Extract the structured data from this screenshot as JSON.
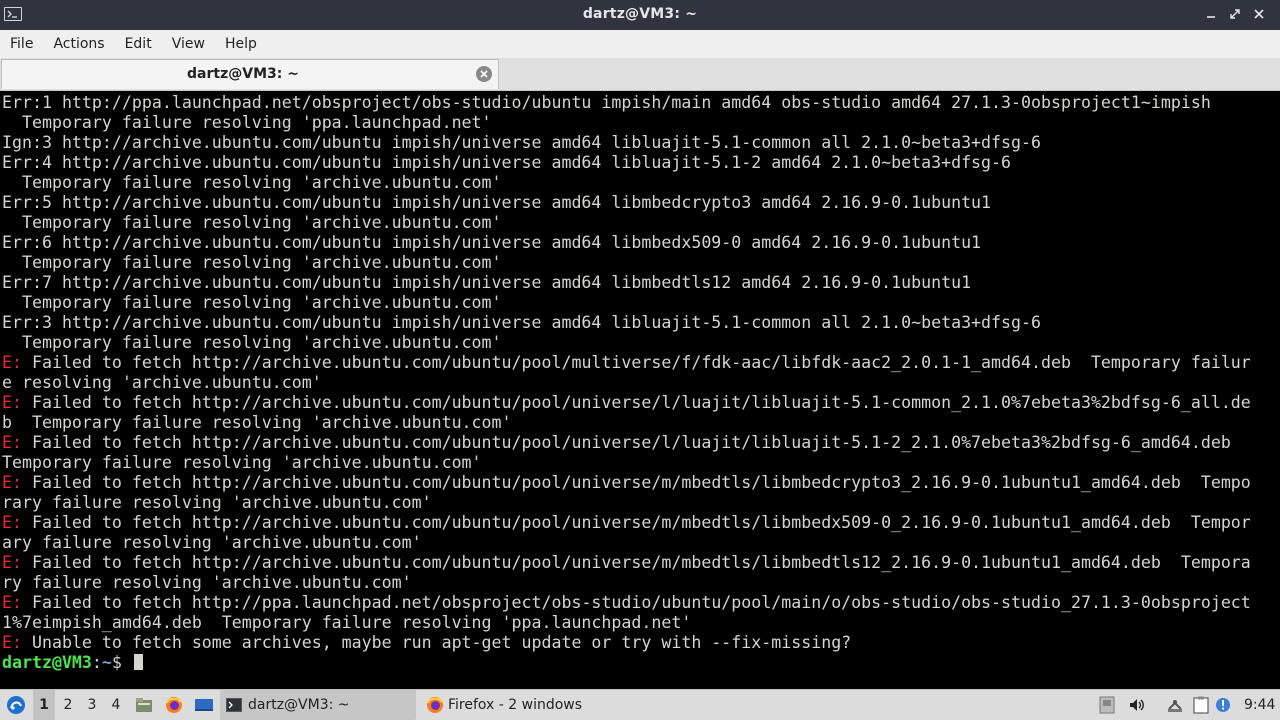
{
  "window": {
    "title": "dartz@VM3: ~"
  },
  "menubar": {
    "items": [
      "File",
      "Actions",
      "Edit",
      "View",
      "Help"
    ]
  },
  "tabs": [
    {
      "label": "dartz@VM3: ~"
    }
  ],
  "terminal": {
    "lines": [
      {
        "parts": [
          {
            "t": "Err:1 http://ppa.launchpad.net/obsproject/obs-studio/ubuntu impish/main amd64 obs-studio amd64 27.1.3-0obsproject1~impish"
          }
        ]
      },
      {
        "parts": [
          {
            "t": "  Temporary failure resolving 'ppa.launchpad.net'"
          }
        ]
      },
      {
        "parts": [
          {
            "t": "Ign:3 http://archive.ubuntu.com/ubuntu impish/universe amd64 libluajit-5.1-common all 2.1.0~beta3+dfsg-6"
          }
        ]
      },
      {
        "parts": [
          {
            "t": "Err:4 http://archive.ubuntu.com/ubuntu impish/universe amd64 libluajit-5.1-2 amd64 2.1.0~beta3+dfsg-6"
          }
        ]
      },
      {
        "parts": [
          {
            "t": "  Temporary failure resolving 'archive.ubuntu.com'"
          }
        ]
      },
      {
        "parts": [
          {
            "t": "Err:5 http://archive.ubuntu.com/ubuntu impish/universe amd64 libmbedcrypto3 amd64 2.16.9-0.1ubuntu1"
          }
        ]
      },
      {
        "parts": [
          {
            "t": "  Temporary failure resolving 'archive.ubuntu.com'"
          }
        ]
      },
      {
        "parts": [
          {
            "t": "Err:6 http://archive.ubuntu.com/ubuntu impish/universe amd64 libmbedx509-0 amd64 2.16.9-0.1ubuntu1"
          }
        ]
      },
      {
        "parts": [
          {
            "t": "  Temporary failure resolving 'archive.ubuntu.com'"
          }
        ]
      },
      {
        "parts": [
          {
            "t": "Err:7 http://archive.ubuntu.com/ubuntu impish/universe amd64 libmbedtls12 amd64 2.16.9-0.1ubuntu1"
          }
        ]
      },
      {
        "parts": [
          {
            "t": "  Temporary failure resolving 'archive.ubuntu.com'"
          }
        ]
      },
      {
        "parts": [
          {
            "t": "Err:3 http://archive.ubuntu.com/ubuntu impish/universe amd64 libluajit-5.1-common all 2.1.0~beta3+dfsg-6"
          }
        ]
      },
      {
        "parts": [
          {
            "t": "  Temporary failure resolving 'archive.ubuntu.com'"
          }
        ]
      },
      {
        "parts": [
          {
            "t": "E:",
            "c": "red"
          },
          {
            "t": " Failed to fetch http://archive.ubuntu.com/ubuntu/pool/multiverse/f/fdk-aac/libfdk-aac2_2.0.1-1_amd64.deb  Temporary failur"
          }
        ]
      },
      {
        "parts": [
          {
            "t": "e resolving 'archive.ubuntu.com'"
          }
        ]
      },
      {
        "parts": [
          {
            "t": "E:",
            "c": "red"
          },
          {
            "t": " Failed to fetch http://archive.ubuntu.com/ubuntu/pool/universe/l/luajit/libluajit-5.1-common_2.1.0%7ebeta3%2bdfsg-6_all.de"
          }
        ]
      },
      {
        "parts": [
          {
            "t": "b  Temporary failure resolving 'archive.ubuntu.com'"
          }
        ]
      },
      {
        "parts": [
          {
            "t": "E:",
            "c": "red"
          },
          {
            "t": " Failed to fetch http://archive.ubuntu.com/ubuntu/pool/universe/l/luajit/libluajit-5.1-2_2.1.0%7ebeta3%2bdfsg-6_amd64.deb"
          }
        ]
      },
      {
        "parts": [
          {
            "t": "Temporary failure resolving 'archive.ubuntu.com'"
          }
        ]
      },
      {
        "parts": [
          {
            "t": "E:",
            "c": "red"
          },
          {
            "t": " Failed to fetch http://archive.ubuntu.com/ubuntu/pool/universe/m/mbedtls/libmbedcrypto3_2.16.9-0.1ubuntu1_amd64.deb  Tempo"
          }
        ]
      },
      {
        "parts": [
          {
            "t": "rary failure resolving 'archive.ubuntu.com'"
          }
        ]
      },
      {
        "parts": [
          {
            "t": "E:",
            "c": "red"
          },
          {
            "t": " Failed to fetch http://archive.ubuntu.com/ubuntu/pool/universe/m/mbedtls/libmbedx509-0_2.16.9-0.1ubuntu1_amd64.deb  Tempor"
          }
        ]
      },
      {
        "parts": [
          {
            "t": "ary failure resolving 'archive.ubuntu.com'"
          }
        ]
      },
      {
        "parts": [
          {
            "t": "E:",
            "c": "red"
          },
          {
            "t": " Failed to fetch http://archive.ubuntu.com/ubuntu/pool/universe/m/mbedtls/libmbedtls12_2.16.9-0.1ubuntu1_amd64.deb  Tempora"
          }
        ]
      },
      {
        "parts": [
          {
            "t": "ry failure resolving 'archive.ubuntu.com'"
          }
        ]
      },
      {
        "parts": [
          {
            "t": "E:",
            "c": "red"
          },
          {
            "t": " Failed to fetch http://ppa.launchpad.net/obsproject/obs-studio/ubuntu/pool/main/o/obs-studio/obs-studio_27.1.3-0obsproject"
          }
        ]
      },
      {
        "parts": [
          {
            "t": "1%7eimpish_amd64.deb  Temporary failure resolving 'ppa.launchpad.net'"
          }
        ]
      },
      {
        "parts": [
          {
            "t": "E:",
            "c": "red"
          },
          {
            "t": " Unable to fetch some archives, maybe run apt-get update or try with --fix-missing?"
          }
        ]
      }
    ],
    "prompt": {
      "user_host": "dartz@VM3",
      "sep": ":",
      "path": "~",
      "symbol": "$ "
    }
  },
  "taskbar": {
    "workspaces": [
      "1",
      "2",
      "3",
      "4"
    ],
    "active_workspace": "1",
    "quick_launch": [
      "file-manager-icon",
      "firefox-icon",
      "desktop-icon"
    ],
    "tasks": [
      {
        "label": "dartz@VM3: ~",
        "icon": "terminal-icon",
        "active": true
      },
      {
        "label": "Firefox - 2 windows",
        "icon": "firefox-icon",
        "active": false
      }
    ],
    "tray": [
      "keyboard-icon",
      "volume-icon",
      "network-icon",
      "clipboard-icon",
      "update-notifier-icon"
    ],
    "clock": "9:44"
  },
  "colors": {
    "titlebar_bg": "#2f343f",
    "terminal_bg": "#000000",
    "terminal_fg": "#d3d7cf",
    "error_red": "#ef2929",
    "prompt_green": "#4be64b",
    "prompt_blue": "#729fcf"
  }
}
